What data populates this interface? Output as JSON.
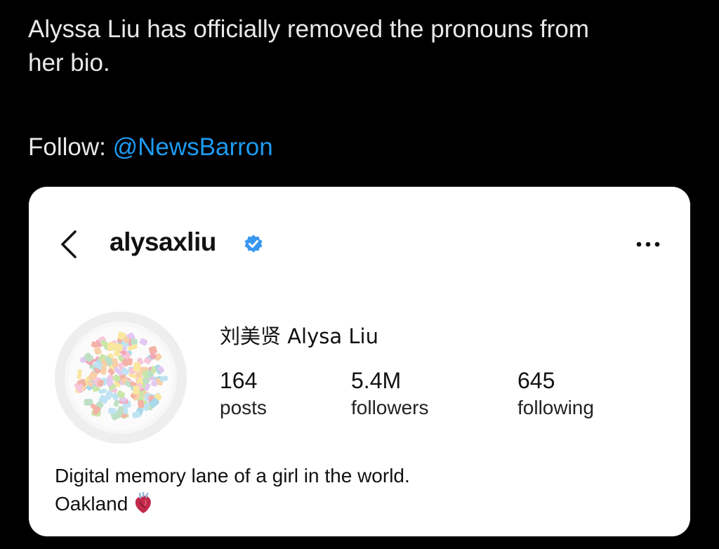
{
  "tweet": {
    "text_line_1": "Alyssa Liu has officially removed the pronouns from",
    "text_line_2": "her bio.",
    "follow_label": "Follow: ",
    "follow_handle": "@NewsBarron"
  },
  "profile": {
    "username": "alysaxliu",
    "display_name": "刘美贤 Alysa Liu",
    "stats": [
      {
        "value": "164",
        "label": "posts"
      },
      {
        "value": "5.4M",
        "label": "followers"
      },
      {
        "value": "645",
        "label": "following"
      }
    ],
    "bio_line_1": "Digital memory lane of a girl in the world.",
    "bio_line_2": "Oakland",
    "icons": {
      "back": "chevron-left-icon",
      "verified": "verified-badge-icon",
      "more": "more-dots-icon",
      "location_emoji": "anatomical-heart-icon"
    }
  },
  "colors": {
    "background": "#000000",
    "tweet_text": "#e7e9ea",
    "mention": "#1d9bf0",
    "card": "#ffffff",
    "verified": "#3897f0"
  }
}
